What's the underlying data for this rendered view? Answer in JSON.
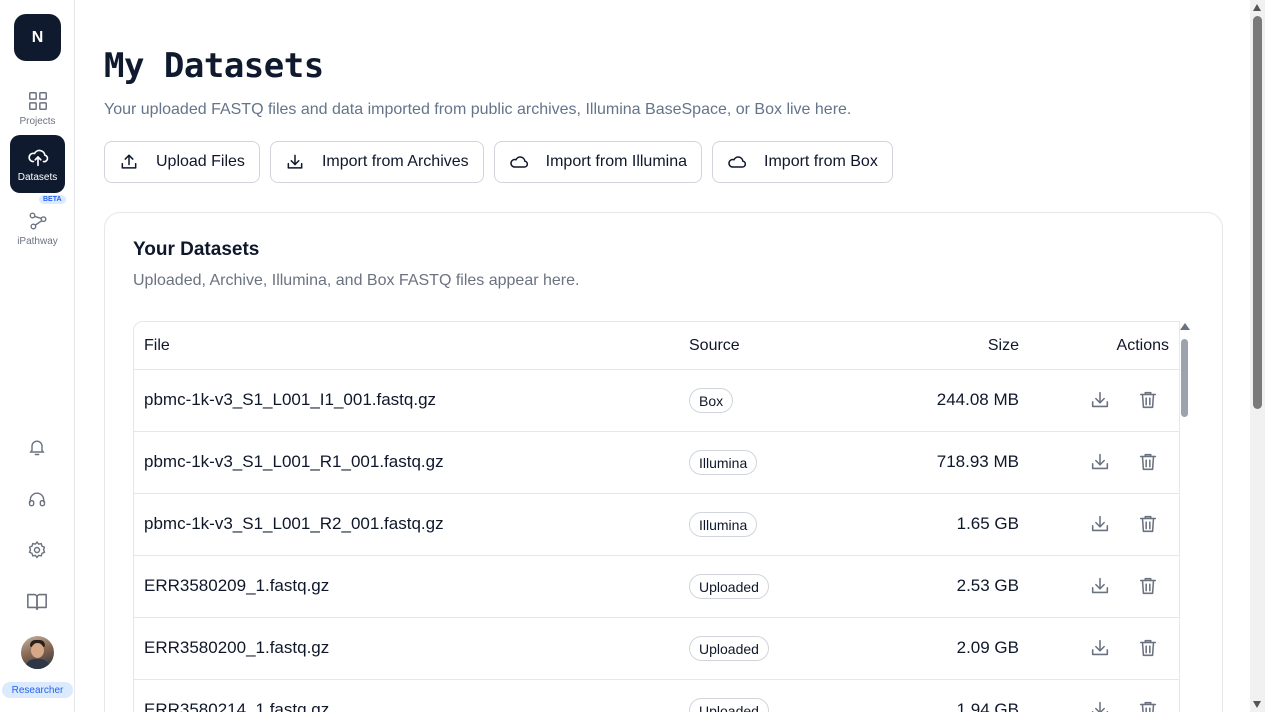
{
  "brand": {
    "initial": "N"
  },
  "sidebar": {
    "items": [
      {
        "label": "Projects",
        "icon": "grid-icon"
      },
      {
        "label": "Datasets",
        "icon": "cloud-upload-icon"
      },
      {
        "label": "iPathway",
        "icon": "pathway-icon",
        "badge": "BETA"
      }
    ],
    "bottom_icons": [
      "bell-icon",
      "headphones-icon",
      "gear-icon",
      "book-icon"
    ],
    "role": "Researcher"
  },
  "page": {
    "title": "My Datasets",
    "subtitle": "Your uploaded FASTQ files and data imported from public archives, Illumina BaseSpace, or Box live here."
  },
  "actions": {
    "upload": "Upload Files",
    "archives": "Import from Archives",
    "illumina": "Import from Illumina",
    "box": "Import from Box"
  },
  "datasets": {
    "title": "Your Datasets",
    "subtitle": "Uploaded, Archive, Illumina, and Box FASTQ files appear here.",
    "columns": {
      "file": "File",
      "source": "Source",
      "size": "Size",
      "actions": "Actions"
    },
    "rows": [
      {
        "file": "pbmc-1k-v3_S1_L001_I1_001.fastq.gz",
        "source": "Box",
        "size": "244.08 MB"
      },
      {
        "file": "pbmc-1k-v3_S1_L001_R1_001.fastq.gz",
        "source": "Illumina",
        "size": "718.93 MB"
      },
      {
        "file": "pbmc-1k-v3_S1_L001_R2_001.fastq.gz",
        "source": "Illumina",
        "size": "1.65 GB"
      },
      {
        "file": "ERR3580209_1.fastq.gz",
        "source": "Uploaded",
        "size": "2.53 GB"
      },
      {
        "file": "ERR3580200_1.fastq.gz",
        "source": "Uploaded",
        "size": "2.09 GB"
      },
      {
        "file": "ERR3580214_1.fastq.gz",
        "source": "Uploaded",
        "size": "1.94 GB"
      }
    ]
  },
  "colors": {
    "brand_dark": "#0f1a2e",
    "accent_blue": "#2563eb",
    "muted": "#64748b"
  }
}
